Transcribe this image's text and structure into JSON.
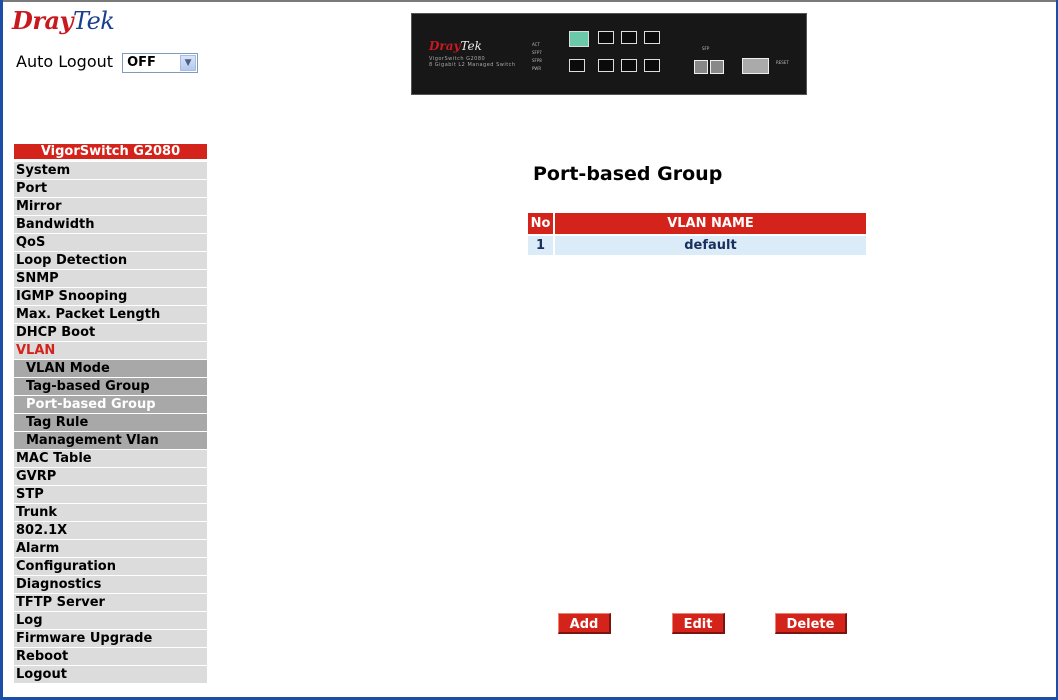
{
  "brand": {
    "dray": "Dray",
    "tek": "Tek"
  },
  "auto_logout": {
    "label": "Auto Logout",
    "selected": "OFF"
  },
  "device": {
    "brand_dray": "Dray",
    "brand_tek": "Tek",
    "model": "VigorSwitch G2080",
    "subtitle": "8 Gigabit L2 Managed Switch",
    "leds": [
      "ACT",
      "SFP7",
      "SFP8",
      "PWR"
    ],
    "sfp_label": "SFP",
    "reset_label": "RESET"
  },
  "sidebar": {
    "title": "VigorSwitch G2080",
    "items": [
      "System",
      "Port",
      "Mirror",
      "Bandwidth",
      "QoS",
      "Loop Detection",
      "SNMP",
      "IGMP Snooping",
      "Max. Packet Length",
      "DHCP Boot",
      "VLAN"
    ],
    "vlan_subitems": [
      "VLAN Mode",
      "Tag-based Group",
      "Port-based Group",
      "Tag Rule",
      "Management Vlan"
    ],
    "items_after": [
      "MAC Table",
      "GVRP",
      "STP",
      "Trunk",
      "802.1X",
      "Alarm",
      "Configuration",
      "Diagnostics",
      "TFTP Server",
      "Log",
      "Firmware Upgrade",
      "Reboot",
      "Logout"
    ]
  },
  "main": {
    "title": "Port-based Group",
    "table": {
      "headers": [
        "No",
        "VLAN NAME"
      ],
      "rows": [
        [
          "1",
          "default"
        ]
      ]
    },
    "buttons": {
      "add": "Add",
      "edit": "Edit",
      "delete": "Delete"
    }
  },
  "colors": {
    "accent_red": "#d4231a",
    "row_blue": "#dcebf8",
    "menu_grey": "#dcdcdc",
    "sub_grey": "#a8a8a8"
  }
}
